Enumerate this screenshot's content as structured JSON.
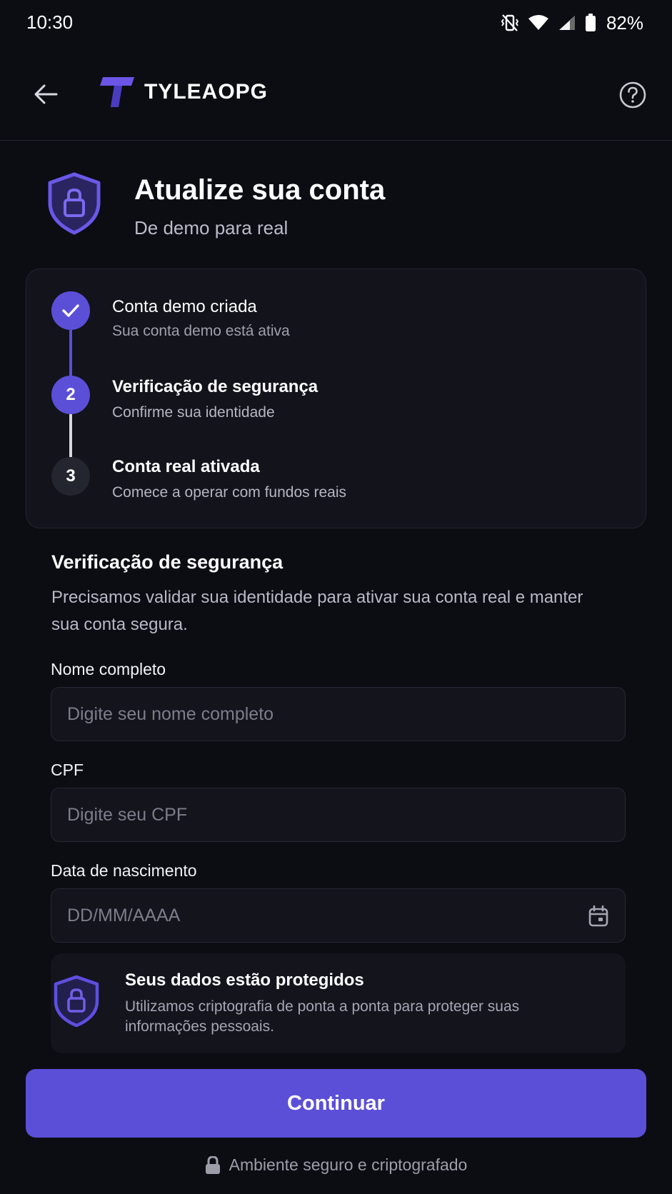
{
  "status_bar": {
    "time": "10:30",
    "battery": "82%"
  },
  "header": {
    "brand": "TYLEAOPG"
  },
  "page": {
    "title": "Atualize sua conta",
    "subtitle": "De demo para real"
  },
  "steps": [
    {
      "number": "",
      "title": "Conta demo criada",
      "description": "Sua conta demo está ativa",
      "state": "done"
    },
    {
      "number": "2",
      "title": "Verificação de segurança",
      "description": "Confirme sua identidade",
      "state": "active"
    },
    {
      "number": "3",
      "title": "Conta real ativada",
      "description": "Comece a operar com fundos reais",
      "state": "pending"
    }
  ],
  "section": {
    "title": "Verificação de segurança",
    "description": "Precisamos validar sua identidade para ativar sua conta real e manter sua conta segura."
  },
  "form": {
    "name": {
      "label": "Nome completo",
      "placeholder": "Digite seu nome completo",
      "value": ""
    },
    "cpf": {
      "label": "CPF",
      "placeholder": "Digite seu CPF",
      "value": ""
    },
    "birth": {
      "label": "Data de nascimento",
      "placeholder": "DD/MM/AAAA",
      "value": ""
    }
  },
  "protected": {
    "title": "Seus dados estão protegidos",
    "description": "Utilizamos criptografia de ponta a ponta para proteger suas informações pessoais."
  },
  "continue_label": "Continuar",
  "footer_note": "Ambiente seguro e criptografado",
  "colors": {
    "accent": "#5b4fd8",
    "background": "#0c0d13",
    "card": "#12131b"
  },
  "icons": [
    "back-arrow-icon",
    "brand-logo-icon",
    "help-icon",
    "shield-lock-icon",
    "check-icon",
    "calendar-icon",
    "lock-icon"
  ]
}
